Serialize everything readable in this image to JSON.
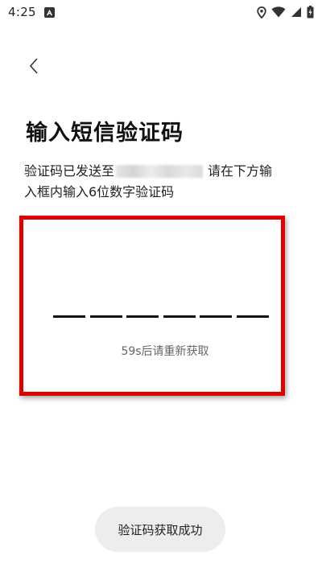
{
  "status_bar": {
    "time": "4:25",
    "notification_icon": "a-box-icon",
    "icons": [
      "location-icon",
      "wifi-icon",
      "signal-icon",
      "battery-charging-icon"
    ]
  },
  "header": {
    "back_icon": "chevron-left-icon",
    "title": "输入短信验证码"
  },
  "description": {
    "prefix": "验证码已发送至",
    "masked_phone": "",
    "line1_suffix": "请在下方输",
    "line2": "入框内输入6位数字验证码"
  },
  "code_input": {
    "digit_count": 6,
    "digits": [
      "",
      "",
      "",
      "",
      "",
      ""
    ]
  },
  "resend": {
    "countdown_text": "59s后请重新获取"
  },
  "toast": {
    "message": "验证码获取成功"
  },
  "colors": {
    "highlight": "#e10000",
    "text_primary": "#111111",
    "text_secondary": "#666666",
    "toast_bg": "#ededed"
  }
}
